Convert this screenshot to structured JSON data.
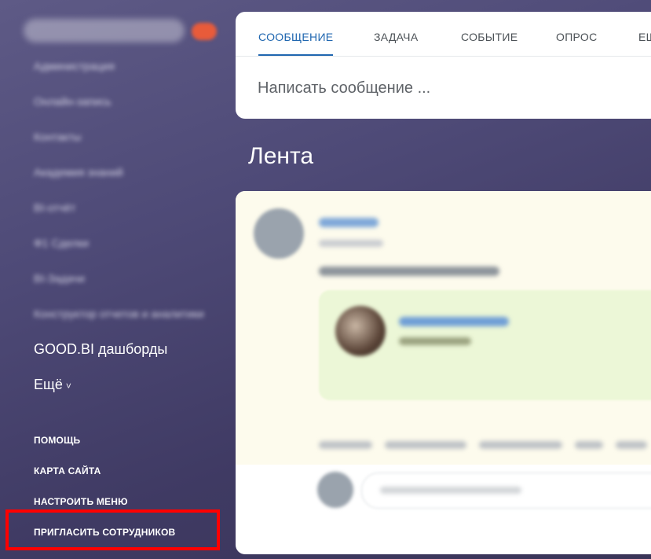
{
  "sidebar": {
    "blurred_items": [
      "Администрация",
      "Онлайн-запись",
      "Контакты",
      "Академия знаний",
      "BI-отчёт",
      "Ф1 Сделки",
      "BI-Задачи",
      "Конструктор отчетов и аналитики"
    ],
    "goodbi_label": "GOOD.BI дашборды",
    "more_label": "Ещё",
    "more_chevron": "˅",
    "help_label": "ПОМОЩЬ",
    "sitemap_label": "КАРТА САЙТА",
    "configure_label": "НАСТРОИТЬ МЕНЮ",
    "invite_label": "ПРИГЛАСИТЬ СОТРУДНИКОВ"
  },
  "composer": {
    "tabs": [
      "СООБЩЕНИЕ",
      "ЗАДАЧА",
      "СОБЫТИЕ",
      "ОПРОС",
      "ЕЩ"
    ],
    "placeholder": "Написать сообщение ..."
  },
  "feed": {
    "title": "Лента"
  },
  "colors": {
    "accent": "#2067b0",
    "highlight": "#ff0000",
    "post_bg": "#fdfbed",
    "attachment_bg": "#ecf7d7"
  }
}
